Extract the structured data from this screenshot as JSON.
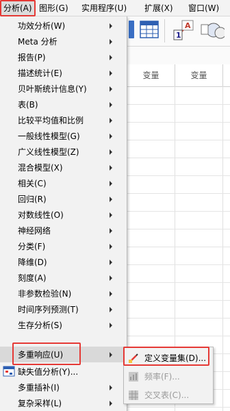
{
  "menubar": {
    "items": [
      {
        "label": "分析(A)",
        "active": true
      },
      {
        "label": "图形(G)"
      },
      {
        "label": "实用程序(U)"
      },
      {
        "label": "扩展(X)"
      },
      {
        "label": "窗口(W)"
      }
    ]
  },
  "grid": {
    "column_headers": [
      "变量",
      "变量"
    ]
  },
  "analyze_menu": {
    "items": [
      {
        "label": "功效分析(W)",
        "submenu": true
      },
      {
        "label": "Meta 分析",
        "submenu": true
      },
      {
        "label": "报告(P)",
        "submenu": true
      },
      {
        "label": "描述统计(E)",
        "submenu": true
      },
      {
        "label": "贝叶斯统计信息(Y)",
        "submenu": true
      },
      {
        "label": "表(B)",
        "submenu": true
      },
      {
        "label": "比较平均值和比例",
        "submenu": true
      },
      {
        "label": "一般线性模型(G)",
        "submenu": true
      },
      {
        "label": "广义线性模型(Z)",
        "submenu": true
      },
      {
        "label": "混合模型(X)",
        "submenu": true
      },
      {
        "label": "相关(C)",
        "submenu": true
      },
      {
        "label": "回归(R)",
        "submenu": true
      },
      {
        "label": "对数线性(O)",
        "submenu": true
      },
      {
        "label": "神经网络",
        "submenu": true
      },
      {
        "label": "分类(F)",
        "submenu": true
      },
      {
        "label": "降维(D)",
        "submenu": true
      },
      {
        "label": "刻度(A)",
        "submenu": true
      },
      {
        "label": "非参数检验(N)",
        "submenu": true
      },
      {
        "label": "时间序列预测(T)",
        "submenu": true
      },
      {
        "label": "生存分析(S)",
        "submenu": true
      },
      {
        "label": "多重响应(U)",
        "submenu": true,
        "selected": true
      },
      {
        "label": "缺失值分析(Y)...",
        "submenu": false,
        "icon": "missing-values-icon"
      },
      {
        "label": "多重插补(I)",
        "submenu": true
      },
      {
        "label": "复杂采样(L)",
        "submenu": true
      }
    ]
  },
  "multiple_response_submenu": {
    "items": [
      {
        "label": "定义变量集(D)...",
        "enabled": true,
        "icon": "define-sets-icon"
      },
      {
        "label": "频率(F)...",
        "enabled": false,
        "icon": "frequencies-icon"
      },
      {
        "label": "交叉表(C)...",
        "enabled": false,
        "icon": "crosstabs-icon"
      }
    ]
  },
  "colors": {
    "highlight": "#e53935",
    "menu_bg": "#f2f2f2",
    "selected_bg": "#d9d9d9",
    "disabled_text": "#9a9a9a"
  }
}
